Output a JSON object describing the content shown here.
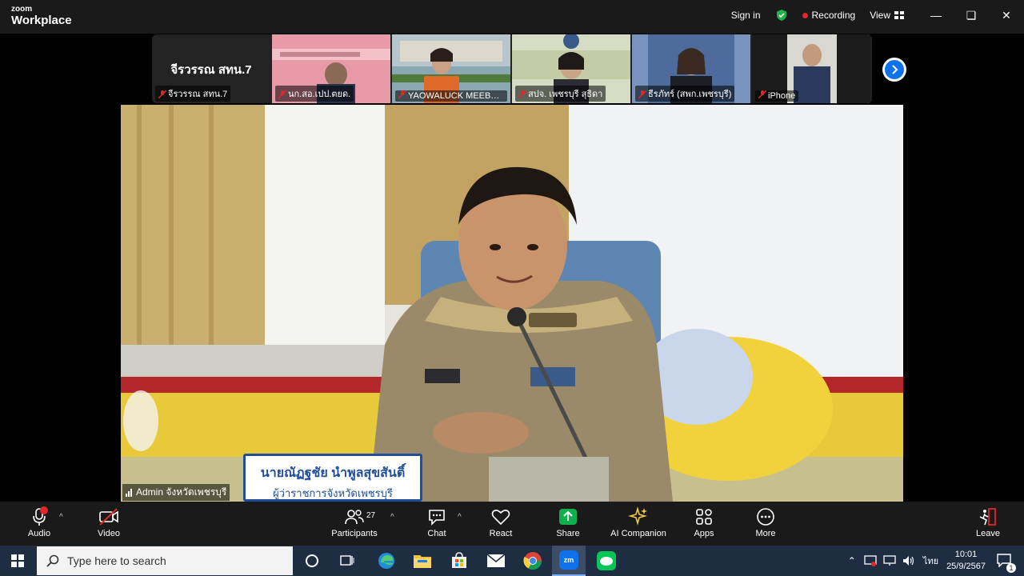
{
  "titlebar": {
    "logo_small": "zoom",
    "logo_big": "Workplace",
    "sign_in": "Sign in",
    "recording": "Recording",
    "view": "View"
  },
  "participants_strip": [
    {
      "name": "จีรวรรณ สทน.7",
      "big_label": "จีรวรรณ สทน.7",
      "bg": "#222222"
    },
    {
      "name": "นก.สอ.เปป.ตยด.",
      "bg": "#e89aa6"
    },
    {
      "name": "YAOWALUCK MEEBU...",
      "bg": "#6b8f9e"
    },
    {
      "name": "สปจ. เพชรบุรี สุธิดา",
      "bg": "#8e9a6e"
    },
    {
      "name": "ธีรภัทร์ (สพก.เพชรบุรี)",
      "bg": "#3b5a8a"
    },
    {
      "name": "iPhone",
      "bg": "#c9c7c0"
    }
  ],
  "main_video": {
    "name": "Admin จังหวัดเพชรบุรี",
    "nameplate_line1": "นายณัฏฐชัย  นำพูลสุขสันติ์",
    "nameplate_line2": "ผู้ว่าราชการจังหวัดเพชรบุรี"
  },
  "toolbar": {
    "audio": "Audio",
    "video": "Video",
    "participants": "Participants",
    "participants_count": "27",
    "chat": "Chat",
    "react": "React",
    "share": "Share",
    "ai_companion": "AI Companion",
    "apps": "Apps",
    "more": "More",
    "leave": "Leave"
  },
  "taskbar": {
    "search_placeholder": "Type here to search",
    "lang": "ไทย",
    "time": "10:01",
    "date": "25/9/2567",
    "notif_count": "1"
  },
  "colors": {
    "share_green": "#0faf4e",
    "leave_red": "#e02828",
    "zoom_blue": "#0e72ed"
  }
}
